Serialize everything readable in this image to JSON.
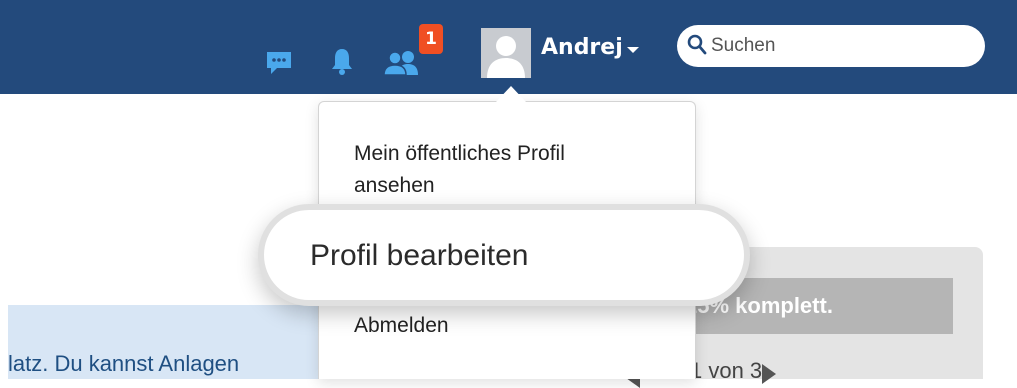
{
  "header": {
    "notification_count": "1",
    "user_name": "Andrej",
    "search_placeholder": "Suchen"
  },
  "user_menu": {
    "view_public_profile": "Mein öffentliches Profil ansehen",
    "edit_profile": "Profil bearbeiten",
    "logout": "Abmelden"
  },
  "background": {
    "info_text": "latz. Du kannst Anlagen",
    "progress_text": "25% komplett.",
    "pager_text": "1 von 3"
  },
  "icons": {
    "chat": "chat-icon",
    "bell": "bell-icon",
    "people": "people-icon",
    "search": "search-icon"
  },
  "colors": {
    "navbar": "#234a7c",
    "badge": "#f04f23",
    "icon": "#4aa8ec"
  }
}
